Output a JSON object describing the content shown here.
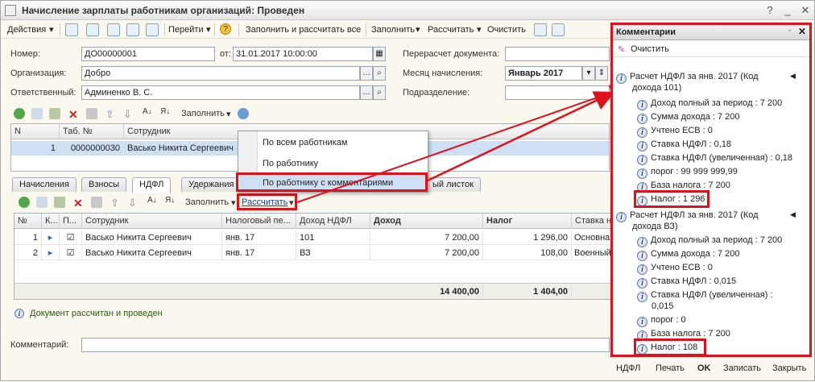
{
  "window": {
    "title": "Начисление зарплаты работникам организаций: Проведен"
  },
  "toolbar": {
    "actions": "Действия",
    "goto": "Перейти",
    "fill_calc_all": "Заполнить и рассчитать все",
    "fill": "Заполнить",
    "calc": "Рассчитать",
    "clear": "Очистить"
  },
  "form": {
    "number_label": "Номер:",
    "number": "ДО00000001",
    "from_label": "от:",
    "date": "31.01.2017 10:00:00",
    "org_label": "Организация:",
    "org": "Добро",
    "resp_label": "Ответственный:",
    "resp": "Админенко В. С.",
    "recalc_label": "Перерасчет документа:",
    "month_label": "Месяц начисления:",
    "month": "Январь 2017",
    "dept_label": "Подразделение:"
  },
  "upper_toolbar": {
    "fill": "Заполнить"
  },
  "upper_grid": {
    "headers": [
      "N",
      "Таб. №",
      "Сотрудник"
    ],
    "rows": [
      [
        "1",
        "0000000030",
        "Васько Никита Сергеевич"
      ]
    ]
  },
  "menu": {
    "items": [
      "По всем работникам",
      "По работнику",
      "По работнику с комментариями"
    ]
  },
  "tabs": [
    "Начисления",
    "Взносы",
    "НДФЛ",
    "Удержания",
    "ый листок"
  ],
  "lower_toolbar": {
    "fill": "Заполнить",
    "calc": "Рассчитать"
  },
  "lower_grid": {
    "headers": [
      "№",
      "К...",
      "П...",
      "Сотрудник",
      "Налоговый пе...",
      "Доход НДФЛ",
      "Доход",
      "Налог",
      "Ставка н"
    ],
    "rows": [
      [
        "1",
        "Васько Никита Сергеевич",
        "янв. 17",
        "101",
        "7 200,00",
        "1 296,00",
        "Основна"
      ],
      [
        "2",
        "Васько Никита Сергеевич",
        "янв. 17",
        "ВЗ",
        "7 200,00",
        "108,00",
        "Военный"
      ]
    ],
    "totals": {
      "income": "14 400,00",
      "tax": "1 404,00"
    }
  },
  "status": "Документ рассчитан и проведен",
  "comment_label": "Комментарий:",
  "comments": {
    "title": "Комментарии",
    "clear": "Очистить",
    "group1": {
      "header1": "Расчет НДФЛ за янв. 2017 (Код",
      "header2": "дохода 101)",
      "items": [
        "Доход полный за период : 7 200",
        "Сумма дохода : 7 200",
        "Учтено ЕСВ : 0",
        "Ставка НДФЛ : 0,18",
        "Ставка НДФЛ (увеличенная) : 0,18",
        "порог : 99 999 999,99",
        "База налога : 7 200",
        "Налог : 1 296"
      ]
    },
    "group2": {
      "header1": "Расчет НДФЛ за янв. 2017 (Код",
      "header2": "дохода ВЗ)",
      "items": [
        "Доход полный за период : 7 200",
        "Сумма дохода : 7 200",
        "Учтено ЕСВ : 0",
        "Ставка НДФЛ : 0,015",
        "Ставка НДФЛ (увеличенная) :",
        "0,015",
        "порог : 0",
        "База налога : 7 200",
        "Налог : 108"
      ]
    }
  },
  "bottom": {
    "ndfl": "НДФЛ",
    "print": "Печать",
    "ok": "OK",
    "save": "Записать",
    "close": "Закрыть"
  },
  "colors": {
    "highlight": "#e0111a",
    "selection": "#cfe0f4"
  }
}
